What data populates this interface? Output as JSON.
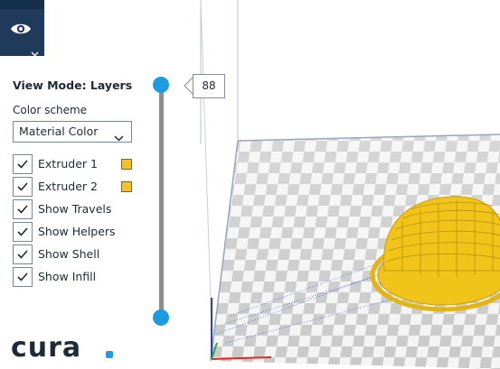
{
  "panel": {
    "title": "View Mode: Layers",
    "color_scheme_label": "Color scheme",
    "color_scheme_value": "Material Color",
    "options": [
      {
        "label": "Extruder 1",
        "checked": true,
        "swatch": "#f2c12e"
      },
      {
        "label": "Extruder 2",
        "checked": true,
        "swatch": "#f2c12e"
      },
      {
        "label": "Show Travels",
        "checked": true
      },
      {
        "label": "Show Helpers",
        "checked": true
      },
      {
        "label": "Show Shell",
        "checked": true
      },
      {
        "label": "Show Infill",
        "checked": true
      }
    ]
  },
  "layer_slider": {
    "current_layer": "88"
  },
  "icons": {
    "view_mode": "eye-icon",
    "dropdown": "chevron-down-icon",
    "checkbox": "check-icon"
  },
  "colors": {
    "accent": "#1e9be0",
    "view_button_bg": "#1f3a5a",
    "model": "#f0c419"
  },
  "brand": {
    "logo": "cura."
  }
}
